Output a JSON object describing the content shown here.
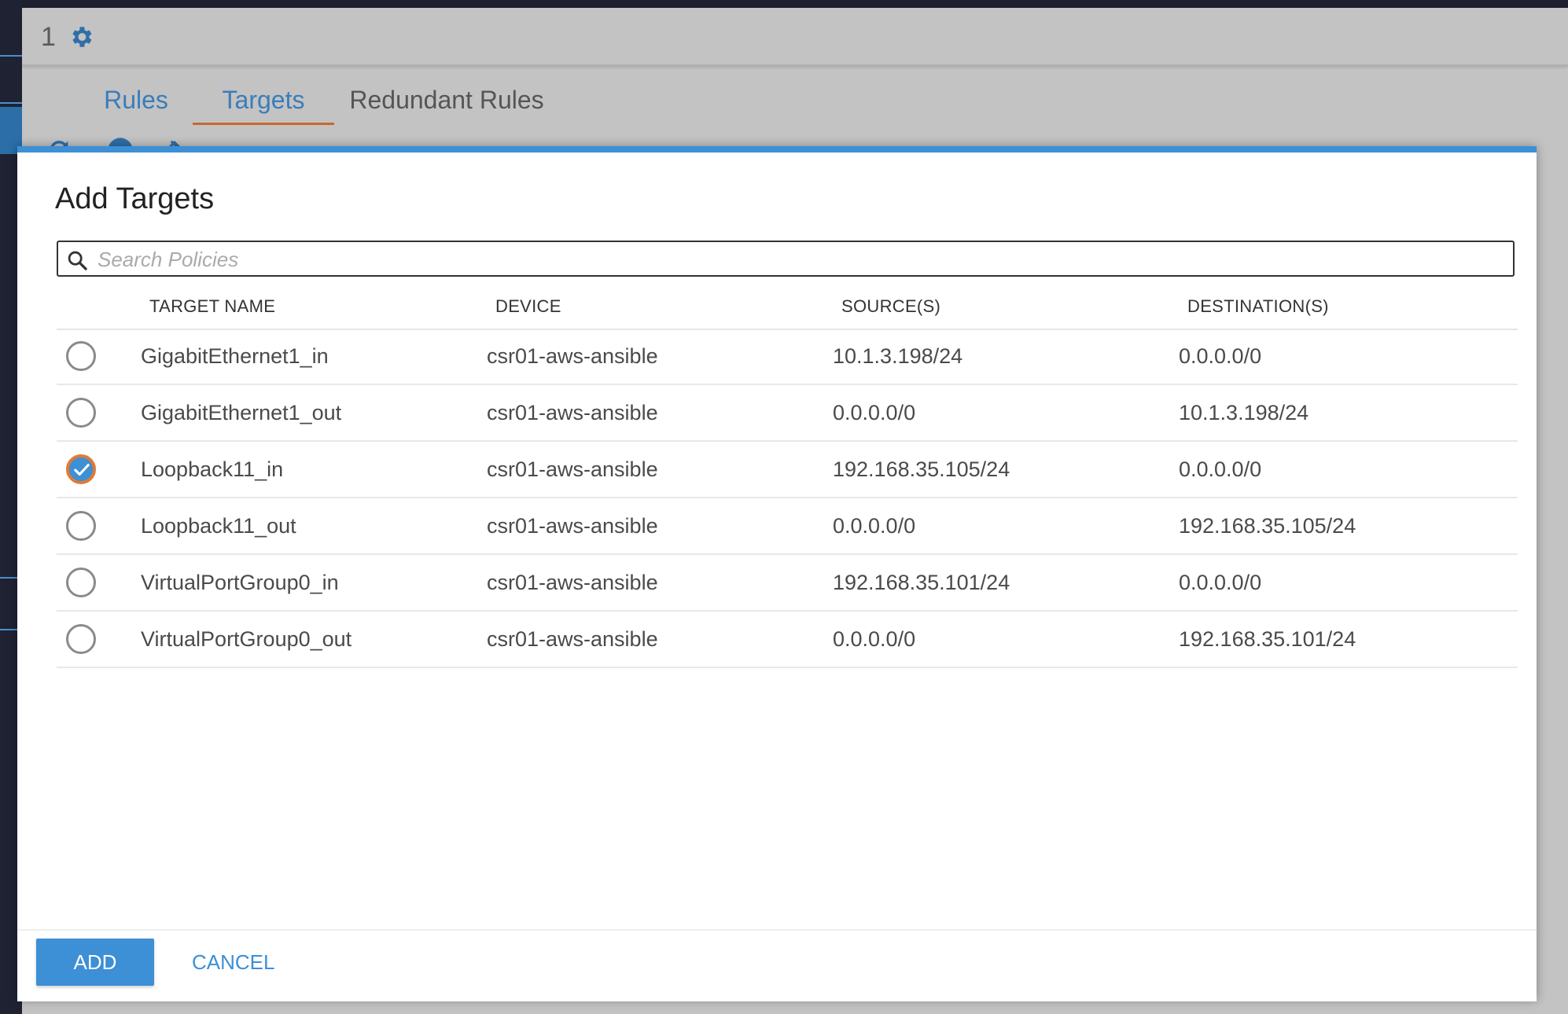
{
  "background": {
    "count": "1",
    "tabs": [
      {
        "label": "Rules"
      },
      {
        "label": "Targets"
      },
      {
        "label": "Redundant Rules"
      }
    ]
  },
  "modal": {
    "title": "Add Targets",
    "search": {
      "placeholder": "Search Policies",
      "value": ""
    },
    "columns": [
      "TARGET NAME",
      "DEVICE",
      "SOURCE(S)",
      "DESTINATION(S)"
    ],
    "rows": [
      {
        "name": "GigabitEthernet1_in",
        "device": "csr01-aws-ansible",
        "source": "10.1.3.198/24",
        "destination": "0.0.0.0/0",
        "selected": false
      },
      {
        "name": "GigabitEthernet1_out",
        "device": "csr01-aws-ansible",
        "source": "0.0.0.0/0",
        "destination": "10.1.3.198/24",
        "selected": false
      },
      {
        "name": "Loopback11_in",
        "device": "csr01-aws-ansible",
        "source": "192.168.35.105/24",
        "destination": "0.0.0.0/0",
        "selected": true
      },
      {
        "name": "Loopback11_out",
        "device": "csr01-aws-ansible",
        "source": "0.0.0.0/0",
        "destination": "192.168.35.105/24",
        "selected": false
      },
      {
        "name": "VirtualPortGroup0_in",
        "device": "csr01-aws-ansible",
        "source": "192.168.35.101/24",
        "destination": "0.0.0.0/0",
        "selected": false
      },
      {
        "name": "VirtualPortGroup0_out",
        "device": "csr01-aws-ansible",
        "source": "0.0.0.0/0",
        "destination": "192.168.35.101/24",
        "selected": false
      }
    ],
    "buttons": {
      "add": "ADD",
      "cancel": "CANCEL"
    }
  },
  "icons": {
    "settings": "gear-icon",
    "search": "search-icon",
    "refresh": "refresh-icon",
    "add": "add-circle-icon",
    "unlink": "unlink-icon",
    "checked": "check-icon"
  },
  "colors": {
    "accent": "#3d8fd6",
    "selected_ring": "#e07a35",
    "active_tab_underline": "#c8692e"
  }
}
